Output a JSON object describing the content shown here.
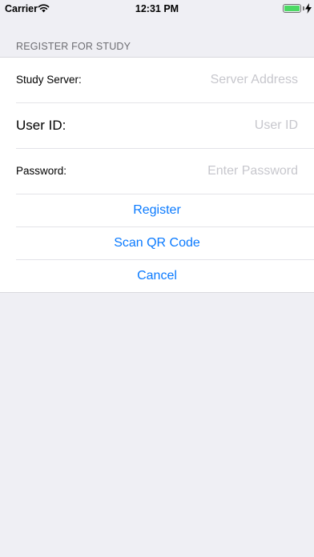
{
  "status_bar": {
    "carrier": "Carrier",
    "time": "12:31 PM"
  },
  "form": {
    "section_header": "REGISTER FOR STUDY",
    "study_server": {
      "label": "Study Server:",
      "placeholder": "Server Address",
      "value": ""
    },
    "user_id": {
      "label": "User ID:",
      "placeholder": "User ID",
      "value": ""
    },
    "password": {
      "label": "Password:",
      "placeholder": "Enter Password",
      "value": ""
    }
  },
  "actions": {
    "register": "Register",
    "scan_qr": "Scan QR Code",
    "cancel": "Cancel"
  },
  "colors": {
    "accent": "#0a7aff",
    "background": "#efeff4",
    "battery": "#4cd964",
    "placeholder": "#c7c7cd"
  },
  "icons": [
    "wifi-icon",
    "battery-icon",
    "charging-bolt-icon"
  ]
}
